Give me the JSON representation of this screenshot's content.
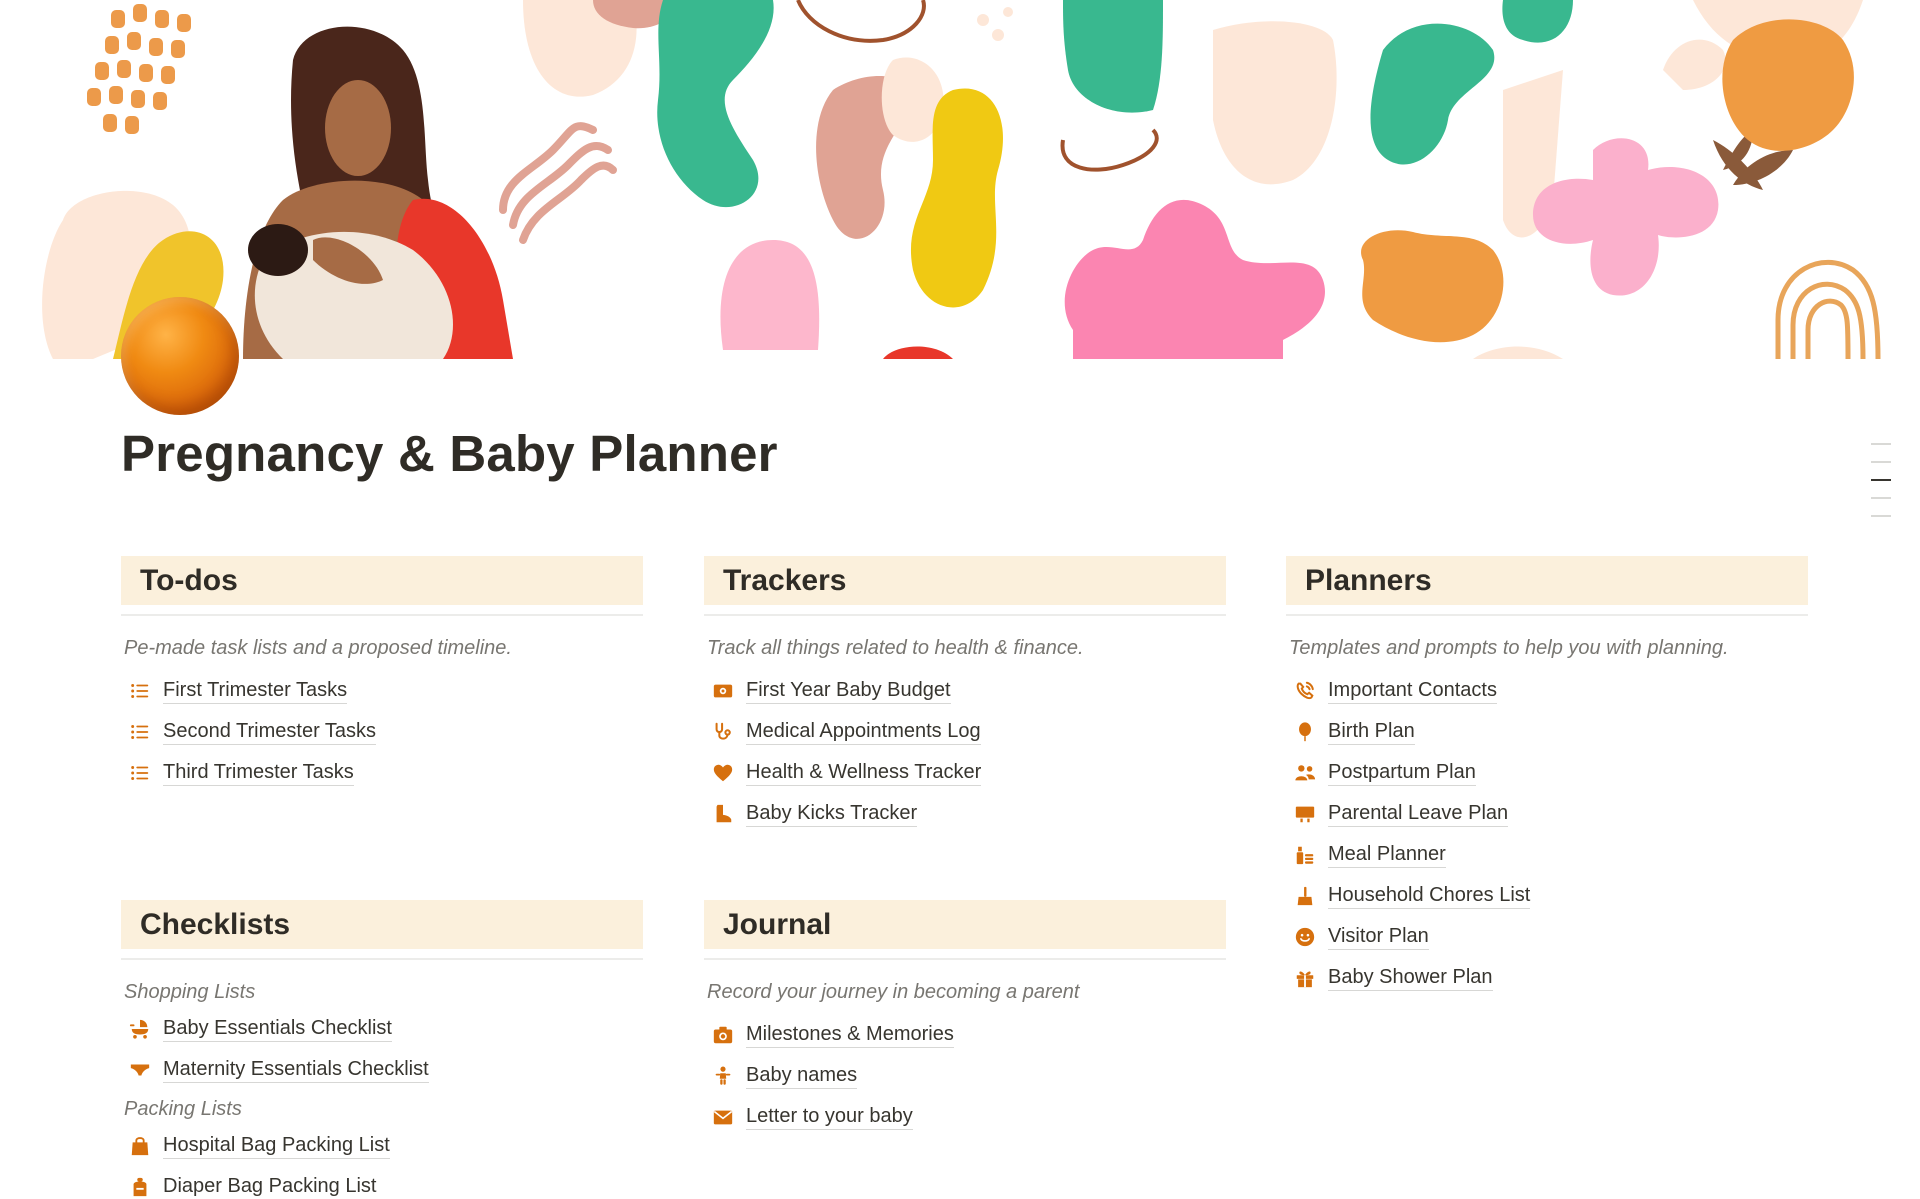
{
  "page": {
    "title": "Pregnancy & Baby Planner",
    "accent_color": "#d6700e",
    "header_bg": "#fbf0dc"
  },
  "sections": {
    "todos": {
      "title": "To-dos",
      "description": "Pe-made task lists and a proposed timeline.",
      "items": [
        {
          "label": "First Trimester Tasks",
          "icon": "list-icon"
        },
        {
          "label": "Second Trimester Tasks",
          "icon": "list-icon"
        },
        {
          "label": "Third Trimester Tasks",
          "icon": "list-icon"
        }
      ]
    },
    "trackers": {
      "title": "Trackers",
      "description": "Track all things related to health & finance.",
      "items": [
        {
          "label": "First Year Baby Budget",
          "icon": "money-icon"
        },
        {
          "label": "Medical Appointments Log",
          "icon": "stethoscope-icon"
        },
        {
          "label": "Health & Wellness Tracker",
          "icon": "heart-icon"
        },
        {
          "label": "Baby Kicks Tracker",
          "icon": "boot-icon"
        }
      ]
    },
    "planners": {
      "title": "Planners",
      "description": "Templates and prompts to help you with planning.",
      "items": [
        {
          "label": "Important Contacts",
          "icon": "phone-icon"
        },
        {
          "label": "Birth Plan",
          "icon": "balloon-icon"
        },
        {
          "label": "Postpartum Plan",
          "icon": "people-icon"
        },
        {
          "label": "Parental Leave Plan",
          "icon": "desk-icon"
        },
        {
          "label": "Meal Planner",
          "icon": "meal-icon"
        },
        {
          "label": "Household Chores List",
          "icon": "broom-icon"
        },
        {
          "label": "Visitor Plan",
          "icon": "smiley-icon"
        },
        {
          "label": "Baby Shower Plan",
          "icon": "gift-icon"
        }
      ]
    },
    "checklists": {
      "title": "Checklists",
      "groups": [
        {
          "heading": "Shopping Lists",
          "items": [
            {
              "label": "Baby Essentials Checklist",
              "icon": "stroller-icon"
            },
            {
              "label": "Maternity Essentials Checklist",
              "icon": "underwear-icon"
            }
          ]
        },
        {
          "heading": "Packing Lists",
          "items": [
            {
              "label": "Hospital Bag Packing List",
              "icon": "bag-icon"
            },
            {
              "label": "Diaper Bag Packing List",
              "icon": "backpack-icon"
            }
          ]
        }
      ]
    },
    "journal": {
      "title": "Journal",
      "description": "Record your journey in becoming a parent",
      "items": [
        {
          "label": "Milestones & Memories",
          "icon": "camera-icon"
        },
        {
          "label": "Baby names",
          "icon": "baby-icon"
        },
        {
          "label": "Letter to your baby",
          "icon": "envelope-icon"
        }
      ]
    }
  }
}
